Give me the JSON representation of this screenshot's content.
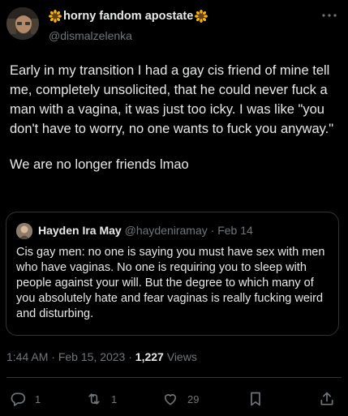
{
  "author": {
    "display_name": "horny fandom apostate",
    "handle": "@dismalzelenka",
    "avatar_icon": "avatar-photo",
    "name_emoji": "sunflower-icon"
  },
  "more_icon": "more-options-icon",
  "tweet": {
    "paragraphs": [
      "Early in my transition I had a gay cis friend of mine tell me, completely unsolicited, that he could never fuck a man with a vagina, it was just too icky. I was like \"you don't have to worry, no one wants to fuck you anyway.\"",
      "We are no longer friends lmao"
    ]
  },
  "quote": {
    "name": "Hayden Ira May",
    "handle": "@haydeniramay",
    "separator": " · ",
    "date": "Feb 14",
    "text": "Cis gay men: no one is saying you must have sex with men who have vaginas. No one is requiring you to sleep with people against your will. But the degree to which many of you absolutely hate and fear vaginas is really fucking weird and disturbing."
  },
  "meta": {
    "time": "1:44 AM",
    "separator1": " · ",
    "date": "Feb 15, 2023",
    "separator2": " · ",
    "views_count": "1,227",
    "views_label": " Views"
  },
  "actions": {
    "reply_count": "1",
    "retweet_count": "1",
    "like_count": "29"
  },
  "colors": {
    "background": "#000000",
    "text": "#e7e9ea",
    "secondary": "#71767b",
    "border": "#2f3336",
    "sunflower": "#f4b400"
  }
}
